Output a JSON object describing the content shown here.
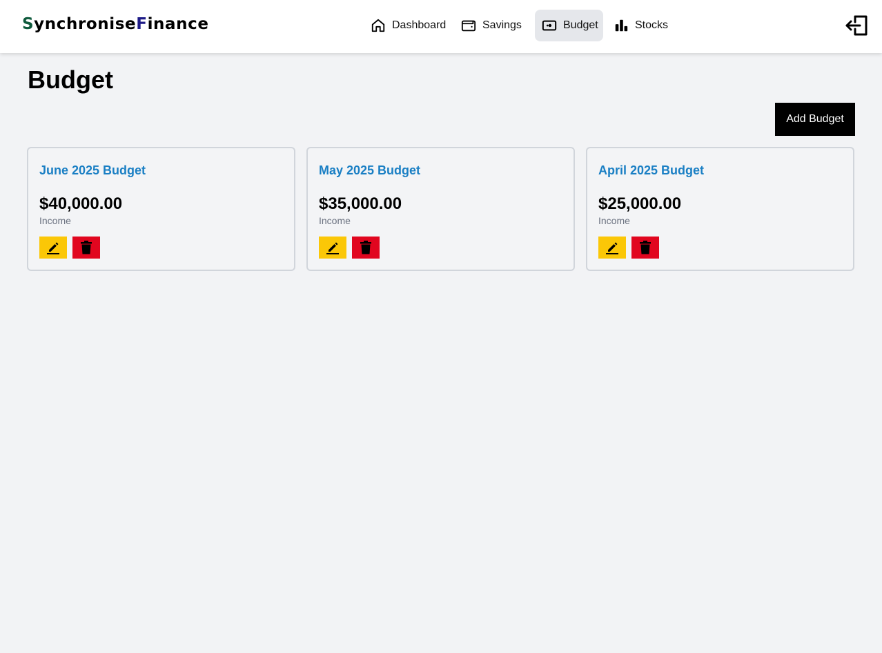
{
  "app": {
    "logo_s": "S",
    "logo_mid": "ynchronise",
    "logo_f": "F",
    "logo_end": "inance"
  },
  "nav": {
    "items": [
      {
        "label": "Dashboard",
        "icon": "home-icon"
      },
      {
        "label": "Savings",
        "icon": "wallet-icon"
      },
      {
        "label": "Budget",
        "icon": "money-icon",
        "active": true
      },
      {
        "label": "Stocks",
        "icon": "bar-chart-icon"
      }
    ],
    "logout_icon": "logout-icon"
  },
  "page": {
    "title": "Budget",
    "add_button": "Add Budget"
  },
  "budgets": [
    {
      "title": "June 2025 Budget",
      "amount": "$40,000.00",
      "label": "Income"
    },
    {
      "title": "May 2025 Budget",
      "amount": "$35,000.00",
      "label": "Income"
    },
    {
      "title": "April 2025 Budget",
      "amount": "$25,000.00",
      "label": "Income"
    }
  ],
  "colors": {
    "accent_blue": "#1a7fc4",
    "edit_yellow": "#fbc707",
    "delete_red": "#e1061f",
    "logo_green": "#0f5a3c",
    "logo_navy": "#1e1b87"
  }
}
